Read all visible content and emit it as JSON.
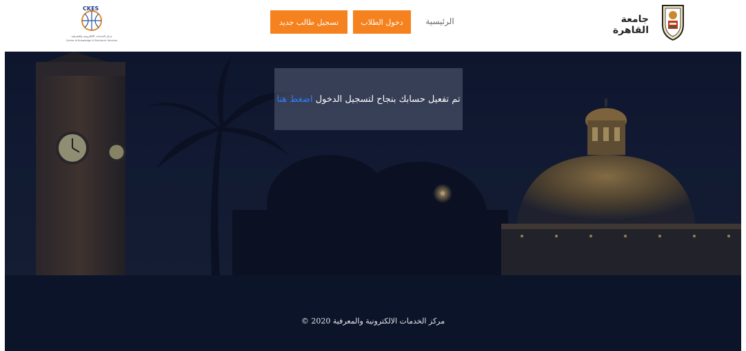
{
  "header": {
    "university_name": "جامعة القاهرة",
    "nav_home": "الرئيسية",
    "login_button": "دخول الطلاب",
    "register_button": "تسجيل طالب جديد",
    "ckes_logo": {
      "acronym": "CKES",
      "arabic_line": "مركز الخدمات الالكترونية والمعرفية",
      "english_line": "Center of Knowledge & Electronic Services"
    }
  },
  "hero": {
    "message_prefix": "تم تفعيل حسابك بنجاح لتسجيل الدخول",
    "message_link": "اضغط هنا"
  },
  "footer": {
    "copyright": "مركز الخدمات الالكترونية والمعرفية 2020 ©"
  },
  "colors": {
    "accent": "#f5821f",
    "link": "#2f7cff",
    "footer_bg": "#0b1428",
    "hero_bg": "#151f37"
  }
}
